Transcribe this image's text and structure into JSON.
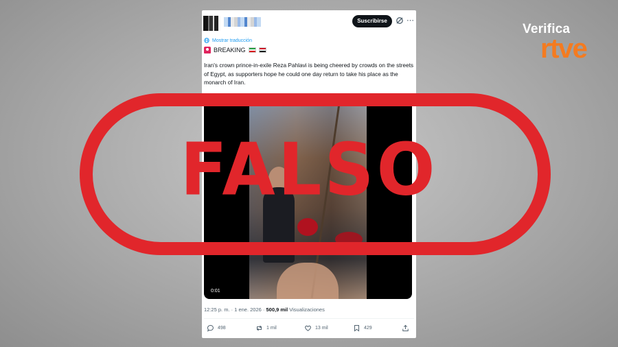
{
  "tweet": {
    "subscribe_label": "Suscribirse",
    "translate_label": "Mostrar traducción",
    "breaking_label": "BREAKING",
    "text": "Iran's crown prince-in-exile Reza Pahlavi is being cheered by crowds on the streets of Egypt, as supporters hope he could one day return to take his place as the monarch of Iran.",
    "video_time": "0:01",
    "posted_time": "12:25 p. m. · 1 ene. 2026 · ",
    "views_count": "500,9 mil",
    "views_label": " Visualizaciones",
    "actions": {
      "replies": "498",
      "reposts": "1 mil",
      "likes": "13 mil",
      "bookmarks": "429"
    },
    "icons": [
      "grok-icon",
      "more-icon",
      "translate-icon",
      "siren-icon",
      "reply-icon",
      "repost-icon",
      "like-icon",
      "bookmark-icon",
      "share-icon"
    ],
    "flags": [
      "iran-flag",
      "egypt-flag"
    ]
  },
  "stamp": {
    "label": "FALSO",
    "color": "#e1262b"
  },
  "brand": {
    "verifica": "Verifica",
    "rtve": "rtve",
    "rtve_color": "#f47b20"
  }
}
